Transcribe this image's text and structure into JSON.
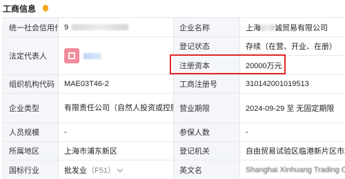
{
  "header": {
    "title": "工商信息",
    "bell_icon": "bell-icon",
    "bell_color": "#f5a623"
  },
  "highlight_color": "#e02424",
  "rows": [
    {
      "left_label": "统一社会信用代码",
      "left_value": "9",
      "right_label": "企业名称",
      "right_value_prefix": "上海",
      "right_value_suffix": "诚贸易有限公司"
    },
    {
      "left_label": "法定代表人",
      "avatar_icon": "avatar-icon",
      "avatar_color": "#f28b9a",
      "right_label": "登记状态",
      "right_value": "存续（在营、开业、在册）"
    },
    {
      "right_label": "注册资本",
      "right_value": "20000万元"
    },
    {
      "left_label": "组织机构代码",
      "left_value": "MAE03T46-2",
      "right_label": "工商注册号",
      "right_value": "310142001019513"
    },
    {
      "left_label": "企业类型",
      "left_value": "有限责任公司（自然人投资或控股的法人独资）",
      "right_label": "营业期限",
      "right_value": "2024-09-29 至 无固定期限"
    },
    {
      "left_label": "人员规模",
      "left_value": "-",
      "right_label": "参保人数",
      "right_value": "-"
    },
    {
      "left_label": "所属地区",
      "left_value": "上海市浦东新区",
      "right_label": "登记机关",
      "right_value": "自由贸易试验区临港新片区市场监督管"
    },
    {
      "left_label": "国标行业",
      "left_value": "批发业",
      "left_value_code": "（F51）",
      "right_label": "英文名",
      "right_value": "Shanghai Xinhuang Trading Co"
    }
  ]
}
